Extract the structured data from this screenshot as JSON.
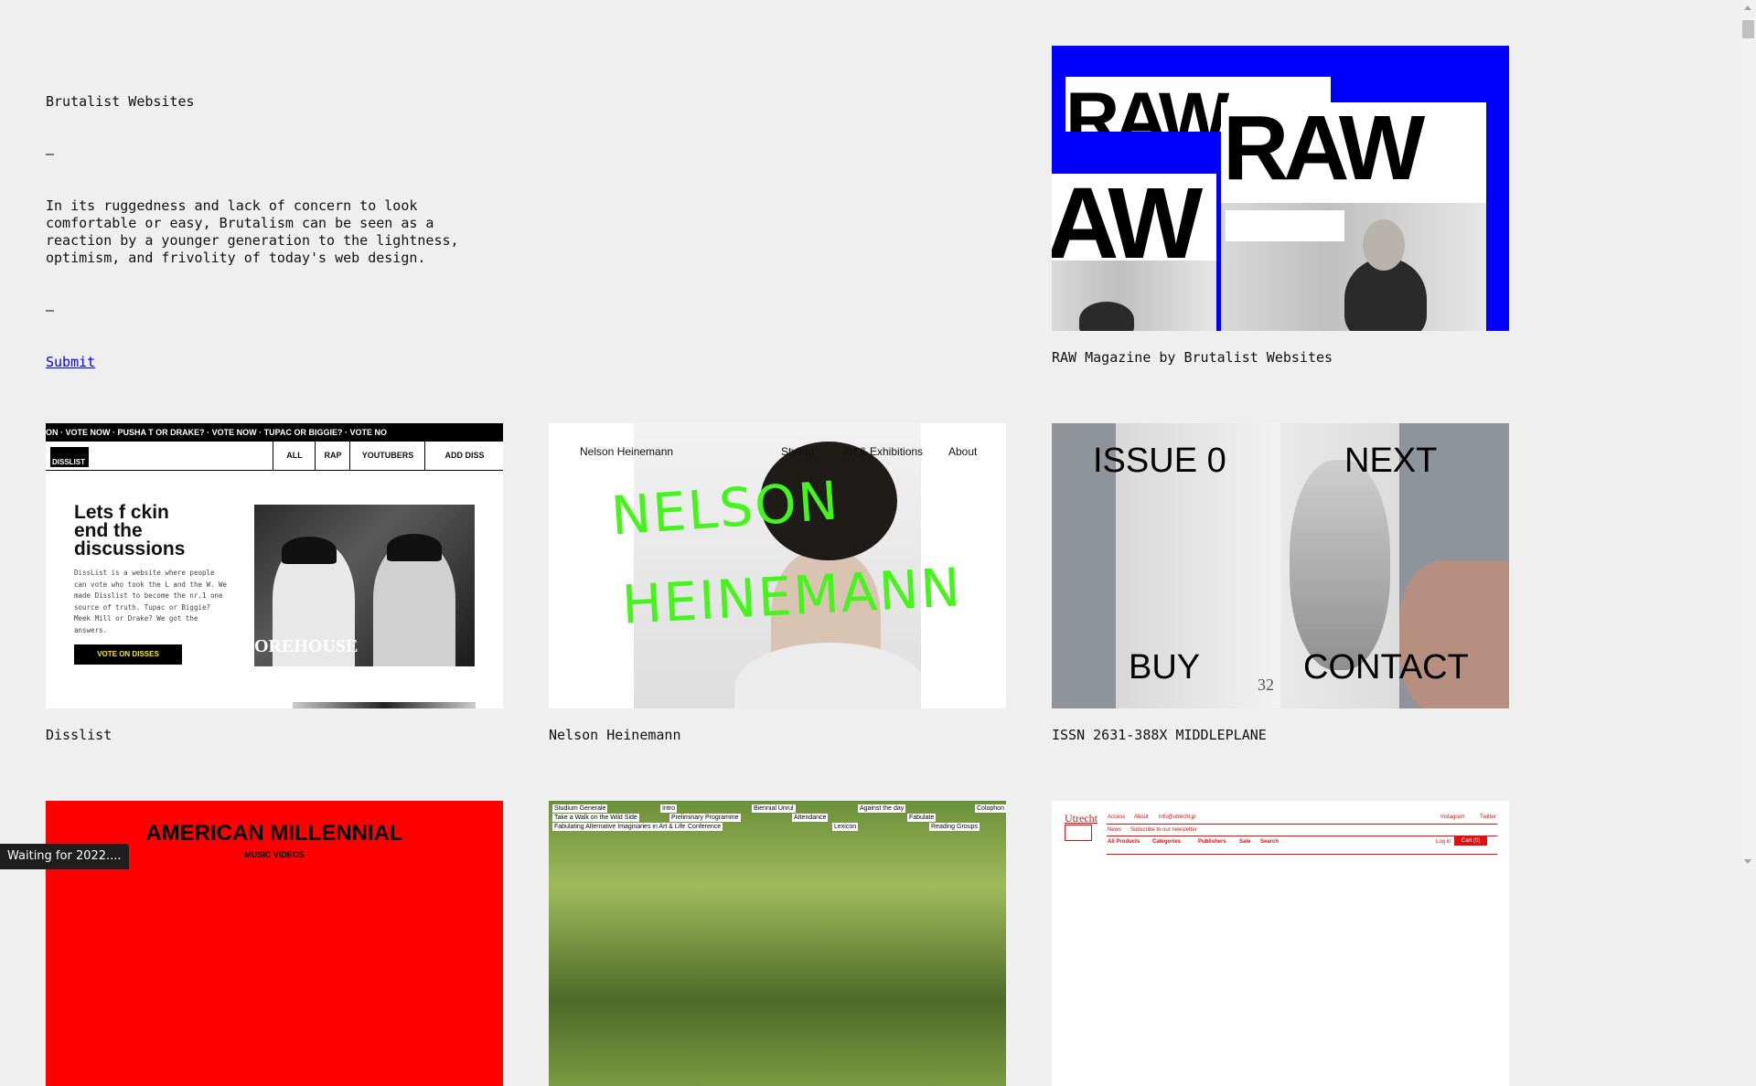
{
  "intro": {
    "title": "Brutalist Websites",
    "dash1": "–",
    "description": "In its ruggedness and lack of concern to look\ncomfortable or easy, Brutalism can be seen as a\nreaction by a younger generation to the lightness,\noptimism, and frivolity of today's web design.",
    "dash2": "–",
    "submit_label": "Submit"
  },
  "cards": [
    {
      "caption": "RAW Magazine by Brutalist Websites",
      "thumb": {
        "word1": "RAW",
        "word2": "RAW",
        "word3": "AW"
      }
    },
    {
      "caption": "Disslist",
      "thumb": {
        "marquee": "ON  ·  VOTE NOW  ·  PUSHA T OR DRAKE?  ·  VOTE NOW  ·  TUPAC OR BIGGIE?  ·  VOTE NO",
        "logo": "DISSLIST",
        "nav": [
          "ALL",
          "RAP",
          "YOUTUBERS",
          "ADD DISS"
        ],
        "title": "Lets f ckin\nend the\ndiscussions",
        "body": "DissList is a website where people can vote who took the L and the W. We made Disslist to become the nr.1 one source of truth. Tupac or Biggie? Meek Mill or Drake? We got the answers.",
        "cta": "VOTE ON DISSES",
        "photo_text": "OREHOUSE"
      }
    },
    {
      "caption": "Nelson Heinemann",
      "thumb": {
        "name": "Nelson Heinemann",
        "nav": [
          "Styling",
          "Art & Exhibitions",
          "About"
        ],
        "script1": "NELSON",
        "script2": "HEINEMANN"
      }
    },
    {
      "caption": "ISSN 2631-388X MIDDLEPLANE",
      "thumb": {
        "tl": "ISSUE 0",
        "tr": "NEXT",
        "bl": "BUY",
        "br": "CONTACT",
        "page": "32"
      }
    },
    {
      "caption": "",
      "thumb": {
        "title": "AMERICAN MILLENNIAL",
        "sub": "MUSIC VIDEOS"
      }
    },
    {
      "caption": "",
      "thumb": {
        "tags": [
          "Studium Generale",
          "Intro",
          "Biennial Unrul",
          "Against the day",
          "Colophon",
          "Take a Walk on the Wild Side",
          "Preliminary Programme",
          "Attendance",
          "Fabulate",
          "Fabulating Alternative Imaginaries in Art & Life",
          "Conference",
          "Lexicon",
          "Reading Groups"
        ]
      }
    },
    {
      "caption": "",
      "thumb": {
        "logo": "Utrecht",
        "top_links": [
          "Access",
          "About",
          "info@utrecht.jp",
          "Instagram",
          "Twitter"
        ],
        "sub_links": [
          "News",
          "Subscribe to our newsletter"
        ],
        "nav": [
          "All Products",
          "Categories",
          "Publishers",
          "Sale",
          "Search"
        ],
        "login": "Log in",
        "cart": "Cart (0)"
      }
    }
  ],
  "status_text": "Waiting for 2022...."
}
